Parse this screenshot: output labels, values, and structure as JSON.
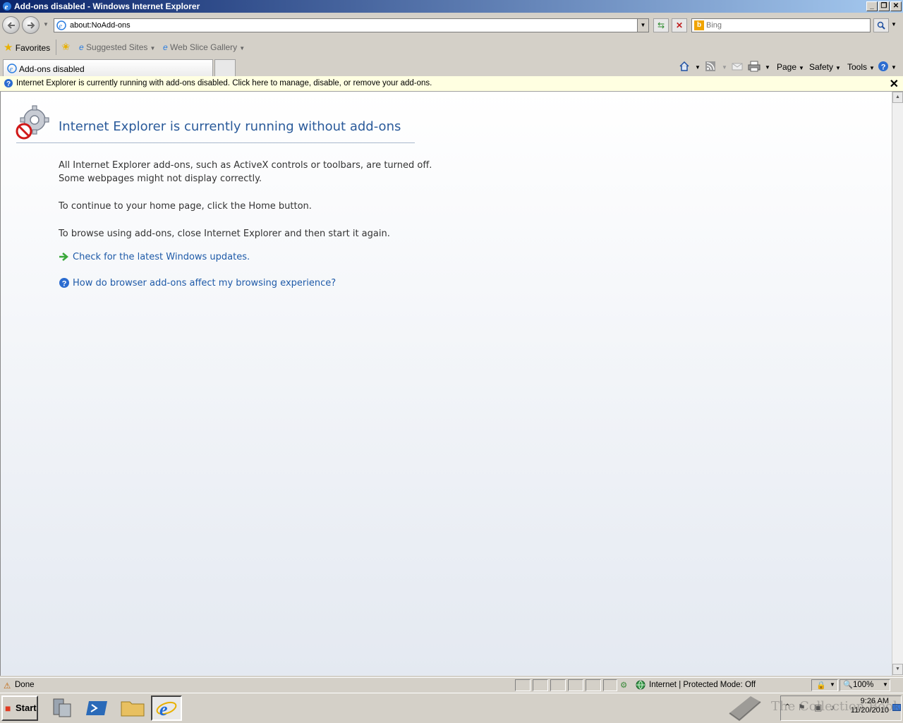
{
  "window": {
    "title": "Add-ons disabled - Windows Internet Explorer"
  },
  "nav": {
    "address": "about:NoAdd-ons",
    "search_placeholder": "Bing",
    "search_brand": "b"
  },
  "favorites": {
    "label": "Favorites",
    "suggested": "Suggested Sites",
    "webslice": "Web Slice Gallery"
  },
  "tab": {
    "label": "Add-ons disabled"
  },
  "commands": {
    "page": "Page",
    "safety": "Safety",
    "tools": "Tools"
  },
  "infobar": {
    "text": "Internet Explorer is currently running with add-ons disabled. Click here to manage, disable, or remove your add-ons."
  },
  "content": {
    "heading": "Internet Explorer is currently running without add-ons",
    "para1_line1": "All Internet Explorer add-ons, such as ActiveX controls or toolbars, are turned off.",
    "para1_line2": "Some webpages might not display correctly.",
    "para2": "To continue to your home page, click the Home button.",
    "para3": "To browse using add-ons, close Internet Explorer and then start it again.",
    "link1": "Check for the latest Windows updates.",
    "link2": "How do browser add-ons affect my browsing experience?"
  },
  "status": {
    "text": "Done",
    "zone": "Internet | Protected Mode: Off",
    "zoom": "100%"
  },
  "taskbar": {
    "start": "Start",
    "time": "9:26 AM",
    "date": "11/20/2010",
    "watermark": "The Collection Book"
  },
  "icons": [
    "ie-icon",
    "back-icon",
    "forward-icon",
    "refresh-icon",
    "stop-icon",
    "search-icon",
    "star-icon",
    "home-icon",
    "feeds-icon",
    "mail-icon",
    "print-icon",
    "help-icon",
    "addons-disabled-icon",
    "arrow-icon",
    "globe-icon"
  ]
}
